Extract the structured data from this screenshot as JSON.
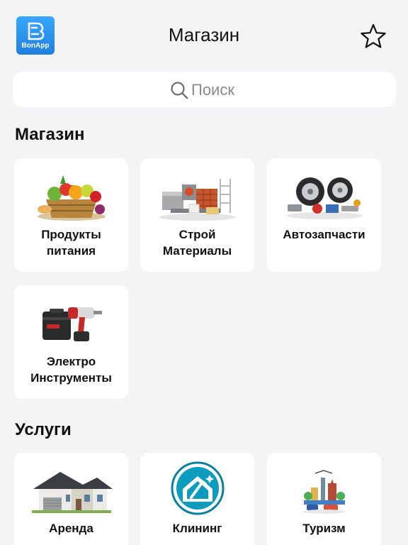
{
  "header": {
    "logo_text": "BonApp",
    "title": "Магазин"
  },
  "search": {
    "placeholder": "Поиск"
  },
  "sections": {
    "shop": {
      "title": "Магазин",
      "items": [
        {
          "label": "Продукты\nпитания",
          "icon": "grocery-basket-image"
        },
        {
          "label": "Строй\nМатериалы",
          "icon": "building-materials-image"
        },
        {
          "label": "Автозапчасти",
          "icon": "car-parts-image"
        },
        {
          "label": "Электро\nИнструменты",
          "icon": "power-drill-image"
        }
      ]
    },
    "services": {
      "title": "Услуги",
      "items": [
        {
          "label": "Аренда",
          "icon": "house-image"
        },
        {
          "label": "Клининг",
          "icon": "cleaning-house-icon"
        },
        {
          "label": "Туризм",
          "icon": "travel-landmarks-image"
        }
      ]
    }
  },
  "colors": {
    "background": "#f4f4f6",
    "card": "#ffffff",
    "logo": "#2a90f0",
    "cleaning_icon": "#0a7fa0"
  }
}
